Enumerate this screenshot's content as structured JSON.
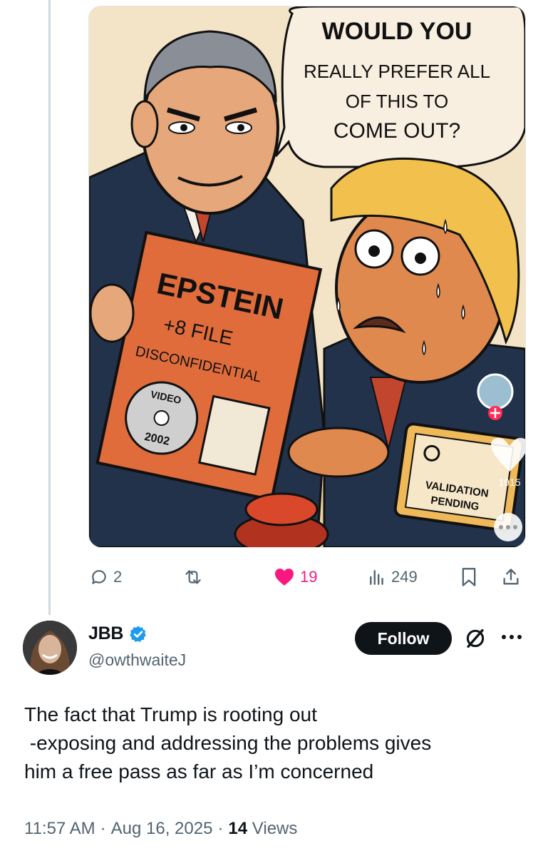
{
  "media": {
    "speech_bubble": [
      "WOULD YOU",
      "REALLY PREFER ALL",
      "OF THIS TO",
      "COME OUT?"
    ],
    "folder": {
      "title": "EPSTEIN",
      "subtitle": "+8 FILE",
      "stamp": "DISCONFIDENTIAL",
      "disc_top": "VIDEO",
      "disc_year": "2002"
    },
    "device": {
      "line1": "VALIDATION",
      "line2": "PENDING"
    },
    "overlay_count": "1915"
  },
  "actions": {
    "reply_count": "2",
    "repost_count": "",
    "like_count": "19",
    "view_count": "249",
    "like_color": "#f91880",
    "icons": [
      "reply-icon",
      "repost-icon",
      "heart-icon",
      "views-icon",
      "bookmark-icon",
      "share-icon"
    ]
  },
  "author": {
    "name": "JBB",
    "handle": "@owthwaiteJ",
    "verified": true,
    "verified_color": "#1d9bf0"
  },
  "follow_label": "Follow",
  "tweet": {
    "lines": [
      "The fact that Trump is rooting out",
      " -exposing and addressing the problems gives",
      "him a free pass as far as I’m concerned"
    ]
  },
  "meta": {
    "time": "11:57 AM",
    "date": "Aug 16, 2025",
    "views_count": "14",
    "views_label": "Views"
  }
}
